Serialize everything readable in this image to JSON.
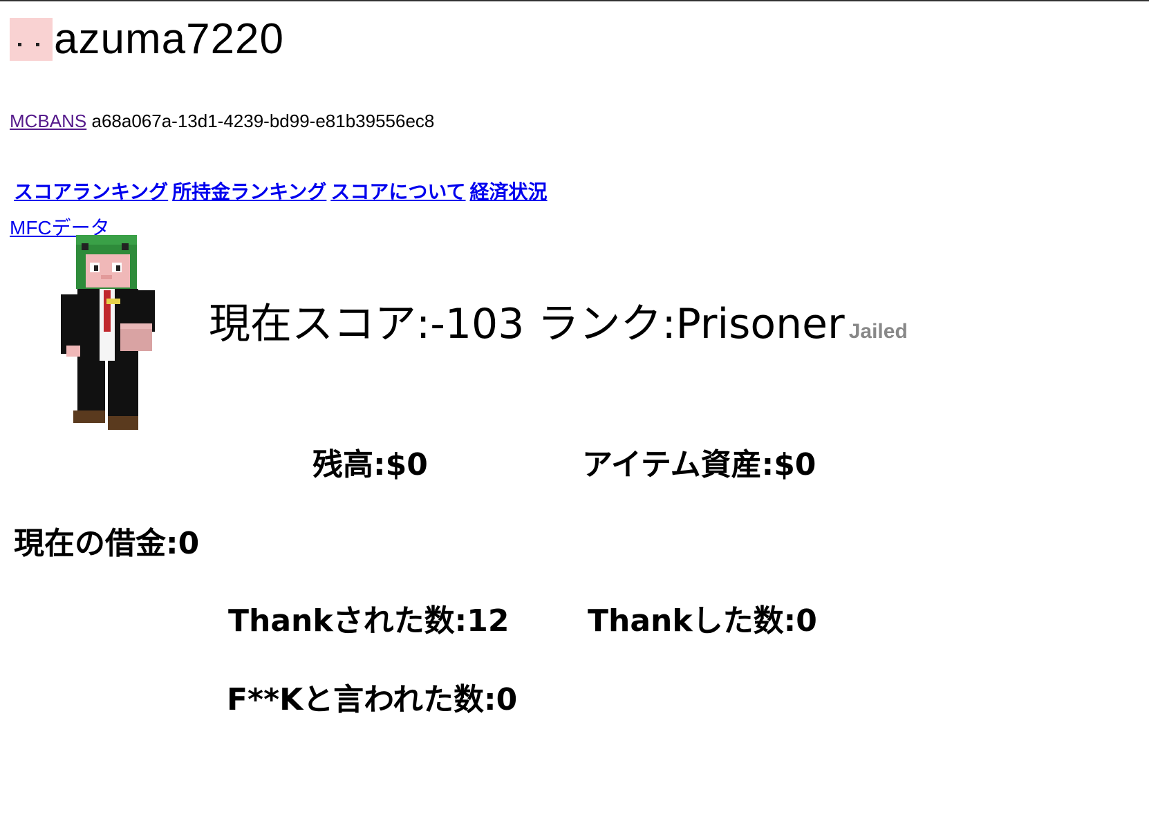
{
  "user": {
    "name": "azuma7220",
    "uuid": "a68a067a-13d1-4239-bd99-e81b39556ec8",
    "mcbans_label": "MCBANS"
  },
  "nav": {
    "links": [
      "スコアランキング",
      "所持金ランキング",
      "スコアについて",
      "経済状況"
    ],
    "mfc_label": "MFCデータ"
  },
  "score": {
    "label": "現在スコア:-103 ランク:Prisoner",
    "status": "Jailed"
  },
  "stats": {
    "balance": "残高:$0",
    "item_assets": "アイテム資産:$0",
    "debt": "現在の借金:0",
    "thanked": "Thankされた数:12",
    "thanks_given": "Thankした数:0",
    "fk": "F**Kと言われた数:0"
  }
}
